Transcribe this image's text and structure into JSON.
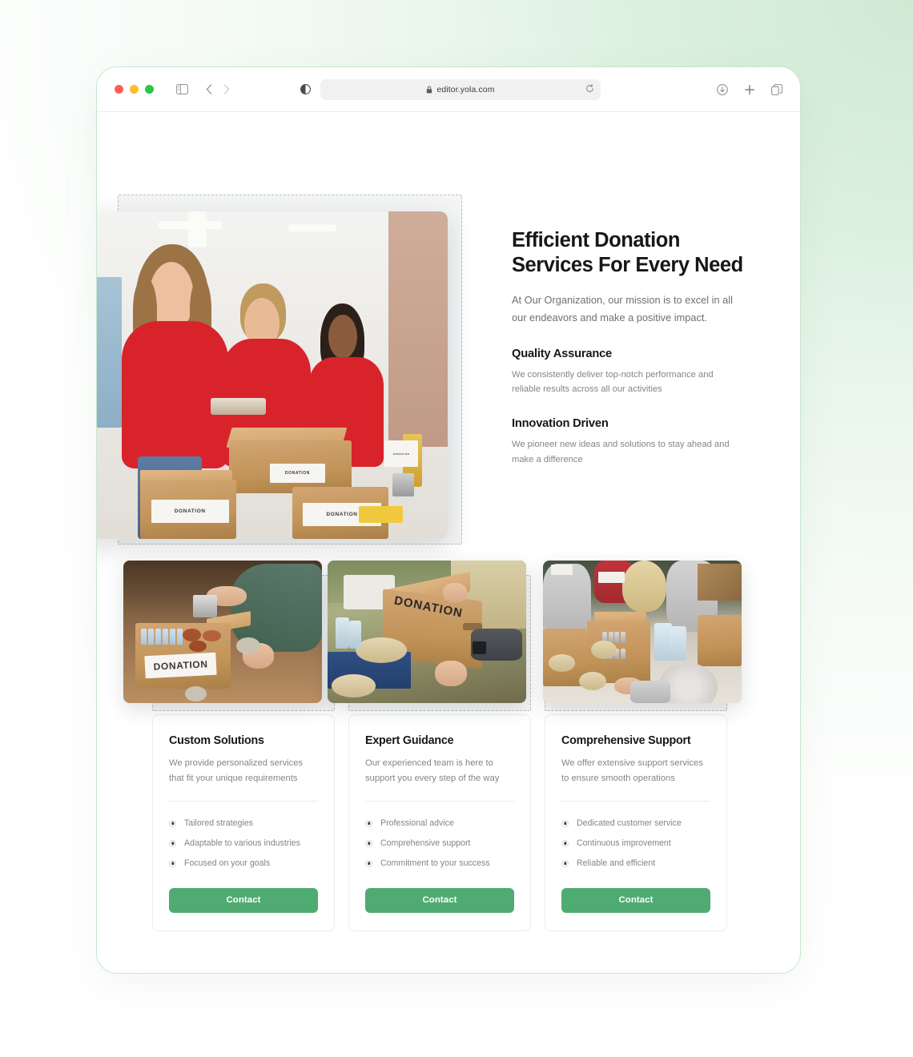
{
  "browser": {
    "url": "editor.yola.com",
    "traffic_lights": [
      "close",
      "minimize",
      "maximize"
    ],
    "icons": {
      "sidebar": "sidebar-toggle-icon",
      "back": "chevron-left-icon",
      "forward": "chevron-right-icon",
      "reader": "reader-mode-icon",
      "lock": "lock-icon",
      "reload": "reload-icon",
      "download": "download-icon",
      "new_tab": "plus-icon",
      "tab_overview": "tab-overview-icon"
    }
  },
  "hero": {
    "title": "Efficient Donation Services For Every Need",
    "subtitle": "At Our Organization, our mission is to excel in all our endeavors and make a positive impact.",
    "image_alt": "Volunteers in red shirts packing DONATION boxes",
    "features": [
      {
        "title": "Quality Assurance",
        "desc": "We consistently deliver top-notch performance and reliable results across all our activities"
      },
      {
        "title": "Innovation Driven",
        "desc": "We pioneer new ideas and solutions to stay ahead and make a difference"
      }
    ]
  },
  "cards": [
    {
      "title": "Custom Solutions",
      "desc": "We provide personalized services that fit your unique requirements",
      "image_alt": "Hand placing a can into a DONATION box on a wooden table",
      "items": [
        "Tailored strategies",
        "Adaptable to various industries",
        "Focused on your goals"
      ],
      "button": "Contact"
    },
    {
      "title": "Expert Guidance",
      "desc": "Our experienced team is here to support you every step of the way",
      "image_alt": "Person carrying a cardboard DONATION box outdoors",
      "items": [
        "Professional advice",
        "Comprehensive support",
        "Commitment to your success"
      ],
      "button": "Contact"
    },
    {
      "title": "Comprehensive Support",
      "desc": "We offer extensive support services to ensure smooth operations",
      "image_alt": "Overhead view of volunteers filling donation boxes with cans and bottles",
      "items": [
        "Dedicated customer service",
        "Continuous improvement",
        "Reliable and efficient"
      ],
      "button": "Contact"
    }
  ],
  "colors": {
    "accent_green": "#4fab72",
    "page_gradient_green": "#cfe9d4",
    "window_border_green": "#c8e6cd",
    "heading": "#15171a",
    "body_text": "#80858c",
    "dashed_border": "#b9bcc0"
  },
  "photo_labels": {
    "hero_box_1": "DONATION",
    "hero_box_2": "DONATION",
    "card1_box": "DONATION",
    "card2_box": "DONATION"
  }
}
